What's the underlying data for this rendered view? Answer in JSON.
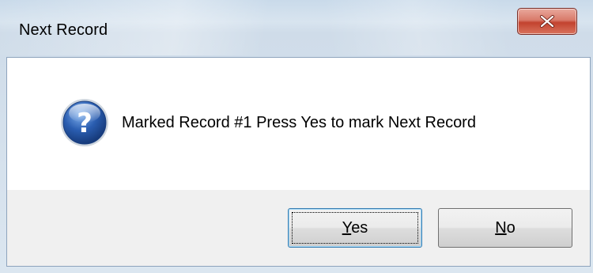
{
  "window": {
    "title": "Next Record"
  },
  "dialog": {
    "icon": "question-icon",
    "message": "Marked Record #1 Press Yes to mark Next Record"
  },
  "buttons": {
    "yes": {
      "mnemonic": "Y",
      "rest": "es"
    },
    "no": {
      "mnemonic": "N",
      "rest": "o"
    }
  },
  "colors": {
    "close_button": "#c7503d",
    "icon_blue": "#2a5db0",
    "content_bg": "#ffffff",
    "button_bar_bg": "#f0f0f0",
    "default_button_border": "#3c7fb1"
  }
}
